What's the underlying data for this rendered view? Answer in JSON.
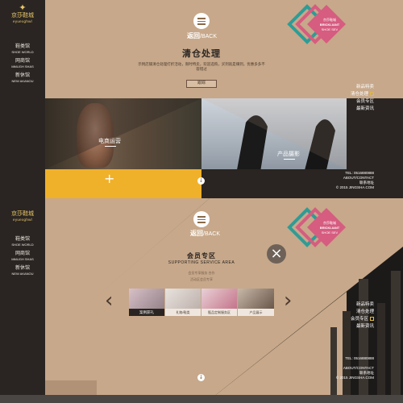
{
  "colors": {
    "tan": "#c7a88a",
    "dark": "#2a2522",
    "gold": "#f0b12a",
    "pink": "#d65c80",
    "teal": "#2e9c96",
    "logo": "#e8c66a"
  },
  "brand": {
    "cn": "京莎鞋城",
    "en": "eyuexghwl"
  },
  "nav": [
    {
      "cn": "鞋类馆",
      "en": "SHOE WORLD"
    },
    {
      "cn": "网商馆",
      "en": "MMUGH SHAS"
    },
    {
      "cn": "新休馆",
      "en": "NEW AKANOU"
    }
  ],
  "screen1": {
    "back_cn": "返回",
    "back_en": "/BACK",
    "title": "清仓处理",
    "desc": "示例店铺清仓处理打折活动，限时特卖，欢迎选购，买到就是赚到，优惠多多不容错过",
    "button": "跟踪",
    "stamp_line1": "京莎鞋城",
    "stamp_line2": "BRICKLIANT",
    "stamp_line3": "SHOE SEV",
    "left_caption": "电商运营",
    "right_caption": "产品摄影",
    "plus": "+",
    "menu": [
      {
        "label": "新品特卖",
        "active": false
      },
      {
        "label": "清仓处理",
        "active": true
      },
      {
        "label": "会员专区",
        "active": false
      },
      {
        "label": "最新资讯",
        "active": false
      }
    ],
    "tel": "TEL: 0516880888",
    "about": "ABOUT/CONTACT",
    "address": "联系地址",
    "copy": "© 2015 JINGSHA.COM",
    "down_icon": "↓"
  },
  "screen2": {
    "back_cn": "返回",
    "back_en": "/BACK",
    "title": "会员专区",
    "subtitle": "SUPPORTING SERVICE AREA",
    "desc1": "会员专享服务 合作",
    "desc2": "活动区会员专享",
    "close_icon": "×",
    "stamp_line1": "京莎鞋城",
    "stamp_line2": "BRICKLIANT",
    "stamp_line3": "SHOE SEV",
    "thumbs": [
      {
        "label": "案例获礼",
        "active": true
      },
      {
        "label": "礼物/鞋类",
        "active": false
      },
      {
        "label": "甄品定制服务区",
        "active": false
      },
      {
        "label": "产品展示",
        "active": false
      }
    ],
    "prev": "‹",
    "next": "›",
    "menu": [
      {
        "label": "新品特卖",
        "active": false
      },
      {
        "label": "清仓处理",
        "active": false
      },
      {
        "label": "会员专区",
        "active": true
      },
      {
        "label": "最新资讯",
        "active": false
      }
    ],
    "tel": "TEL: 0516880888",
    "about": "ABOUT/CONTACT",
    "address": "联系地址",
    "copy": "© 2015 JINGSHA.COM",
    "down_icon": "↓"
  }
}
